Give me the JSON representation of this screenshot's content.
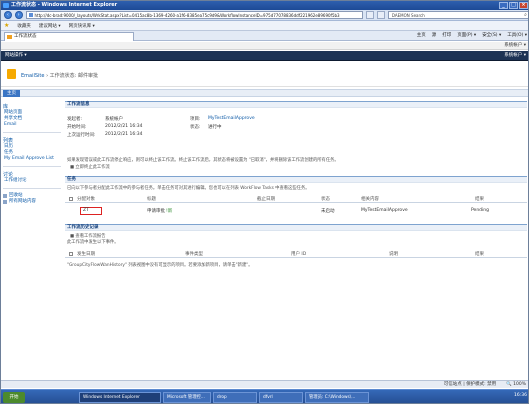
{
  "window": {
    "title": "工作流状态 - Windows Internet Explorer",
    "controls": [
      "_",
      "□",
      "×"
    ]
  },
  "addressbar": {
    "url": "http://dc-brad:9000/_layouts/WrkStat.aspx?List=0415ac8b-1369-4260-a1f6-8385ea75c9d9&WorkflowInstanceID=975d77078836ddf221962e89690f5b3",
    "search_placeholder": "DAEMON Search"
  },
  "favorites": {
    "label": "收藏夹",
    "items": [
      "建议网站 ▾",
      "网页快讯库 ▾"
    ]
  },
  "tab": {
    "label": "工作流状态",
    "tools": [
      "主页",
      "源",
      "打印",
      "页面(P) ▾",
      "安全(S) ▾",
      "工具(O) ▾"
    ]
  },
  "sharepoint": {
    "top_right": "系统帐户 ▾",
    "site_actions": "网站操作 ▾",
    "breadcrumb": {
      "site": "EmailSite",
      "sep": " › ",
      "page": "工作流状态: 邮件审批"
    },
    "home_tab": "主页"
  },
  "quicklaunch": {
    "libraries_head": "库",
    "libraries": [
      "网站页面",
      "共享文档",
      "Email"
    ],
    "lists_head": "列表",
    "lists": [
      "日历",
      "任务",
      "My Email Approve List"
    ],
    "discussions_head": "讨论",
    "discussions": [
      "工作组讨论"
    ],
    "bottom": [
      "回收站",
      "所有网站内容"
    ]
  },
  "workflow_info": {
    "header": "工作流信息",
    "rows": [
      {
        "label": "发起者:",
        "value": "系统帐户"
      },
      {
        "label": "开始时间:",
        "value": "2012/2/21 16:34"
      },
      {
        "label": "上次运行时间:",
        "value": "2012/2/21 16:34"
      }
    ],
    "right_rows": [
      {
        "label": "项目:",
        "value": "MyTestEmailApprove"
      },
      {
        "label": "状态:",
        "value": "进行中"
      }
    ],
    "notice": "如果发现错误或此工作流停止响应，则可以终止该工作流。终止该工作流后，其状态将被设置为 \"已取消\"，并将删除该工作流创建的所有任务。",
    "terminate_link": "■ 立即终止此工作流"
  },
  "tasks": {
    "header": "任务",
    "description": "已向以下参与者分配此工作流中的参与者任务。单击任务可对其进行编辑。您也可以在列表 WorkFlow Tasks 中查看这些任务。",
    "columns": [
      "分配对象",
      "标题",
      "截止日期",
      "状态",
      "相关内容",
      "结果"
    ],
    "rows": [
      {
        "assignee": "ZT",
        "title": "申请审批",
        "new_badge": "!新",
        "due": "",
        "status": "未启动",
        "related": "MyTestEmailApprove",
        "outcome": "Pending"
      }
    ]
  },
  "history": {
    "header": "工作流历史记录",
    "view_report": "■ 查看工作流报告",
    "description": "此工作流中发生以下事件。",
    "columns": [
      "发生日期",
      "事件类型",
      "用户 ID",
      "说明",
      "结果"
    ],
    "empty_text": "\"GroupCityFlowWanHistory\" 列表视图中没有可显示的项目。若要添加新项目，请单击\"新建\"。"
  },
  "statusbar": {
    "left": "",
    "right": [
      "可信站点 | 保护模式: 禁用",
      "🔍 100%"
    ]
  },
  "taskbar": {
    "start": "开始",
    "items": [
      "Windows Internet Explorer",
      "Microsoft 管理控...",
      "drop",
      "dfvrl",
      "管理员: C:\\Windows\\..."
    ],
    "clock": "16:36"
  }
}
